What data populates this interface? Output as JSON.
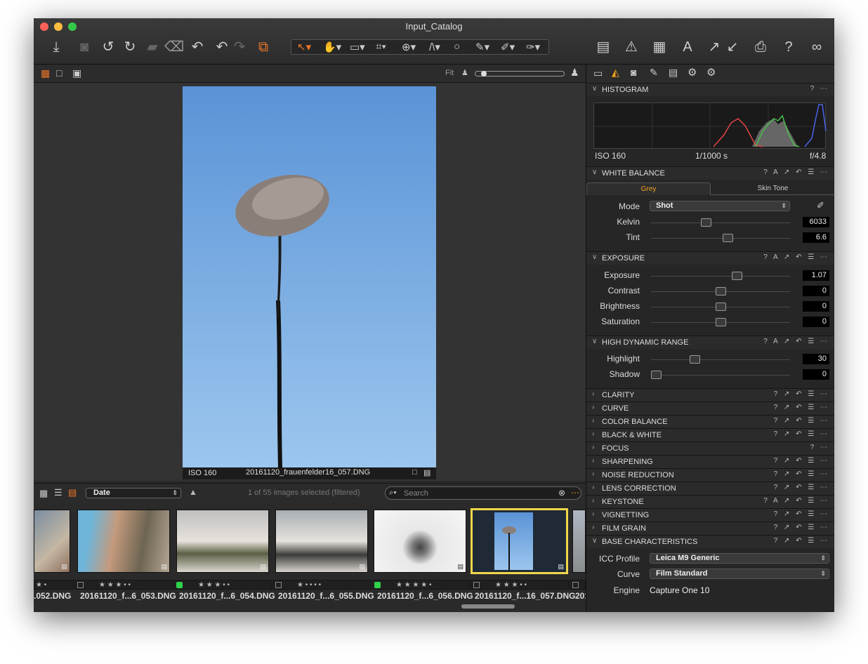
{
  "app": {
    "title": "Input_Catalog"
  },
  "viewer": {
    "fit_label": "Fit",
    "iso": "ISO 160",
    "filename": "20161120_frauenfelder16_057.DNG"
  },
  "browser": {
    "sort": "Date",
    "status": "1 of 55 images selected (filtered)",
    "search_placeholder": "Search"
  },
  "thumbnails": [
    {
      "name": ".052.DNG",
      "rating": "★  •",
      "color": ""
    },
    {
      "name": "20161120_f...6_053.DNG",
      "rating": "★ ★ ★  •  •",
      "color": ""
    },
    {
      "name": "20161120_f...6_054.DNG",
      "rating": "★ ★ ★  •  •",
      "color": "#2fd24a"
    },
    {
      "name": "20161120_f...6_055.DNG",
      "rating": "★  •  •  •  •",
      "color": ""
    },
    {
      "name": "20161120_f...6_056.DNG",
      "rating": "★ ★ ★ ★  •",
      "color": "#2fd24a"
    },
    {
      "name": "20161120_f...16_057.DNG",
      "rating": "★ ★ ★  •  •",
      "color": ""
    },
    {
      "name": "201",
      "rating": "",
      "color": ""
    }
  ],
  "histogram": {
    "title": "HISTOGRAM",
    "iso": "ISO 160",
    "shutter": "1/1000 s",
    "aperture": "f/4.8"
  },
  "white_balance": {
    "title": "WHITE BALANCE",
    "tab_grey": "Grey",
    "tab_skin": "Skin Tone",
    "mode_label": "Mode",
    "mode_value": "Shot",
    "kelvin_label": "Kelvin",
    "kelvin_value": "6033",
    "tint_label": "Tint",
    "tint_value": "6.6",
    "kelvin_level": 0.39,
    "tint_level": 0.56
  },
  "exposure": {
    "title": "EXPOSURE",
    "rows": [
      {
        "label": "Exposure",
        "value": "1.07",
        "level": 0.63
      },
      {
        "label": "Contrast",
        "value": "0",
        "level": 0.5
      },
      {
        "label": "Brightness",
        "value": "0",
        "level": 0.5
      },
      {
        "label": "Saturation",
        "value": "0",
        "level": 0.5
      }
    ]
  },
  "hdr": {
    "title": "HIGH DYNAMIC RANGE",
    "rows": [
      {
        "label": "Highlight",
        "value": "30",
        "level": 0.3
      },
      {
        "label": "Shadow",
        "value": "0",
        "level": 0
      }
    ]
  },
  "collapsed_sections": [
    "CLARITY",
    "CURVE",
    "COLOR BALANCE",
    "BLACK & WHITE",
    "FOCUS",
    "SHARPENING",
    "NOISE REDUCTION",
    "LENS CORRECTION",
    "KEYSTONE",
    "VIGNETTING",
    "FILM GRAIN"
  ],
  "base": {
    "title": "BASE CHARACTERISTICS",
    "icc_label": "ICC Profile",
    "icc_value": "Leica M9 Generic",
    "curve_label": "Curve",
    "curve_value": "Film Standard",
    "engine_label": "Engine",
    "engine_value": "Capture One 10"
  }
}
